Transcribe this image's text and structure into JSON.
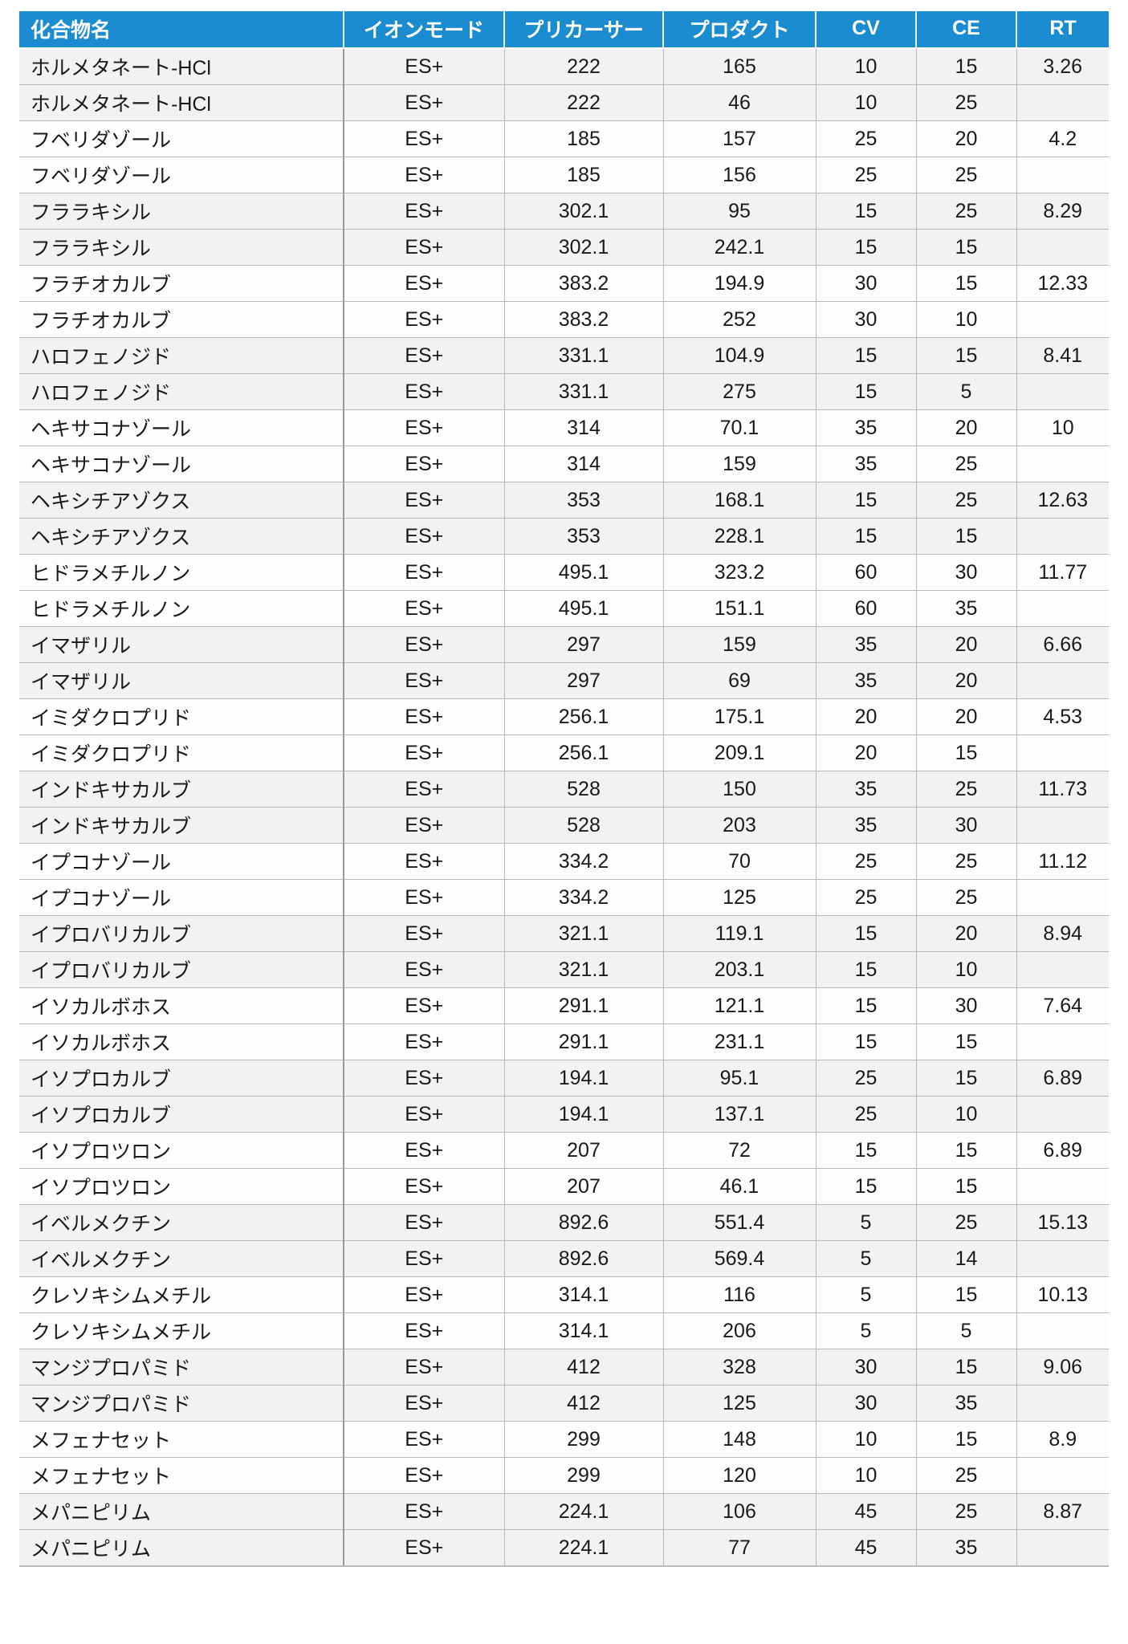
{
  "table": {
    "columns": [
      {
        "key": "name",
        "label": "化合物名"
      },
      {
        "key": "mode",
        "label": "イオンモード"
      },
      {
        "key": "precursor",
        "label": "プリカーサー"
      },
      {
        "key": "product",
        "label": "プロダクト"
      },
      {
        "key": "cv",
        "label": "CV"
      },
      {
        "key": "ce",
        "label": "CE"
      },
      {
        "key": "rt",
        "label": "RT"
      }
    ],
    "header_background": "#1b8cd0",
    "header_text_color": "#ffffff",
    "rows": [
      {
        "name": "ホルメタネート-HCl",
        "mode": "ES+",
        "precursor": "222",
        "product": "165",
        "cv": "10",
        "ce": "15",
        "rt": "3.26"
      },
      {
        "name": "ホルメタネート-HCl",
        "mode": "ES+",
        "precursor": "222",
        "product": "46",
        "cv": "10",
        "ce": "25",
        "rt": ""
      },
      {
        "name": "フベリダゾール",
        "mode": "ES+",
        "precursor": "185",
        "product": "157",
        "cv": "25",
        "ce": "20",
        "rt": "4.2"
      },
      {
        "name": "フベリダゾール",
        "mode": "ES+",
        "precursor": "185",
        "product": "156",
        "cv": "25",
        "ce": "25",
        "rt": ""
      },
      {
        "name": "フララキシル",
        "mode": "ES+",
        "precursor": "302.1",
        "product": "95",
        "cv": "15",
        "ce": "25",
        "rt": "8.29"
      },
      {
        "name": "フララキシル",
        "mode": "ES+",
        "precursor": "302.1",
        "product": "242.1",
        "cv": "15",
        "ce": "15",
        "rt": ""
      },
      {
        "name": "フラチオカルブ",
        "mode": "ES+",
        "precursor": "383.2",
        "product": "194.9",
        "cv": "30",
        "ce": "15",
        "rt": "12.33"
      },
      {
        "name": "フラチオカルブ",
        "mode": "ES+",
        "precursor": "383.2",
        "product": "252",
        "cv": "30",
        "ce": "10",
        "rt": ""
      },
      {
        "name": "ハロフェノジド",
        "mode": "ES+",
        "precursor": "331.1",
        "product": "104.9",
        "cv": "15",
        "ce": "15",
        "rt": "8.41"
      },
      {
        "name": "ハロフェノジド",
        "mode": "ES+",
        "precursor": "331.1",
        "product": "275",
        "cv": "15",
        "ce": "5",
        "rt": ""
      },
      {
        "name": "ヘキサコナゾール",
        "mode": "ES+",
        "precursor": "314",
        "product": "70.1",
        "cv": "35",
        "ce": "20",
        "rt": "10"
      },
      {
        "name": "ヘキサコナゾール",
        "mode": "ES+",
        "precursor": "314",
        "product": "159",
        "cv": "35",
        "ce": "25",
        "rt": ""
      },
      {
        "name": "ヘキシチアゾクス",
        "mode": "ES+",
        "precursor": "353",
        "product": "168.1",
        "cv": "15",
        "ce": "25",
        "rt": "12.63"
      },
      {
        "name": "ヘキシチアゾクス",
        "mode": "ES+",
        "precursor": "353",
        "product": "228.1",
        "cv": "15",
        "ce": "15",
        "rt": ""
      },
      {
        "name": "ヒドラメチルノン",
        "mode": "ES+",
        "precursor": "495.1",
        "product": "323.2",
        "cv": "60",
        "ce": "30",
        "rt": "11.77"
      },
      {
        "name": "ヒドラメチルノン",
        "mode": "ES+",
        "precursor": "495.1",
        "product": "151.1",
        "cv": "60",
        "ce": "35",
        "rt": ""
      },
      {
        "name": "イマザリル",
        "mode": "ES+",
        "precursor": "297",
        "product": "159",
        "cv": "35",
        "ce": "20",
        "rt": "6.66"
      },
      {
        "name": "イマザリル",
        "mode": "ES+",
        "precursor": "297",
        "product": "69",
        "cv": "35",
        "ce": "20",
        "rt": ""
      },
      {
        "name": "イミダクロプリド",
        "mode": "ES+",
        "precursor": "256.1",
        "product": "175.1",
        "cv": "20",
        "ce": "20",
        "rt": "4.53"
      },
      {
        "name": "イミダクロプリド",
        "mode": "ES+",
        "precursor": "256.1",
        "product": "209.1",
        "cv": "20",
        "ce": "15",
        "rt": ""
      },
      {
        "name": "インドキサカルブ",
        "mode": "ES+",
        "precursor": "528",
        "product": "150",
        "cv": "35",
        "ce": "25",
        "rt": "11.73"
      },
      {
        "name": "インドキサカルブ",
        "mode": "ES+",
        "precursor": "528",
        "product": "203",
        "cv": "35",
        "ce": "30",
        "rt": ""
      },
      {
        "name": "イプコナゾール",
        "mode": "ES+",
        "precursor": "334.2",
        "product": "70",
        "cv": "25",
        "ce": "25",
        "rt": "11.12"
      },
      {
        "name": "イプコナゾール",
        "mode": "ES+",
        "precursor": "334.2",
        "product": "125",
        "cv": "25",
        "ce": "25",
        "rt": ""
      },
      {
        "name": "イプロバリカルブ",
        "mode": "ES+",
        "precursor": "321.1",
        "product": "119.1",
        "cv": "15",
        "ce": "20",
        "rt": "8.94"
      },
      {
        "name": "イプロバリカルブ",
        "mode": "ES+",
        "precursor": "321.1",
        "product": "203.1",
        "cv": "15",
        "ce": "10",
        "rt": ""
      },
      {
        "name": "イソカルボホス",
        "mode": "ES+",
        "precursor": "291.1",
        "product": "121.1",
        "cv": "15",
        "ce": "30",
        "rt": "7.64"
      },
      {
        "name": "イソカルボホス",
        "mode": "ES+",
        "precursor": "291.1",
        "product": "231.1",
        "cv": "15",
        "ce": "15",
        "rt": ""
      },
      {
        "name": "イソプロカルブ",
        "mode": "ES+",
        "precursor": "194.1",
        "product": "95.1",
        "cv": "25",
        "ce": "15",
        "rt": "6.89"
      },
      {
        "name": "イソプロカルブ",
        "mode": "ES+",
        "precursor": "194.1",
        "product": "137.1",
        "cv": "25",
        "ce": "10",
        "rt": ""
      },
      {
        "name": "イソプロツロン",
        "mode": "ES+",
        "precursor": "207",
        "product": "72",
        "cv": "15",
        "ce": "15",
        "rt": "6.89"
      },
      {
        "name": "イソプロツロン",
        "mode": "ES+",
        "precursor": "207",
        "product": "46.1",
        "cv": "15",
        "ce": "15",
        "rt": ""
      },
      {
        "name": "イベルメクチン",
        "mode": "ES+",
        "precursor": "892.6",
        "product": "551.4",
        "cv": "5",
        "ce": "25",
        "rt": "15.13"
      },
      {
        "name": "イベルメクチン",
        "mode": "ES+",
        "precursor": "892.6",
        "product": "569.4",
        "cv": "5",
        "ce": "14",
        "rt": ""
      },
      {
        "name": "クレソキシムメチル",
        "mode": "ES+",
        "precursor": "314.1",
        "product": "116",
        "cv": "5",
        "ce": "15",
        "rt": "10.13"
      },
      {
        "name": "クレソキシムメチル",
        "mode": "ES+",
        "precursor": "314.1",
        "product": "206",
        "cv": "5",
        "ce": "5",
        "rt": ""
      },
      {
        "name": "マンジプロパミド",
        "mode": "ES+",
        "precursor": "412",
        "product": "328",
        "cv": "30",
        "ce": "15",
        "rt": "9.06"
      },
      {
        "name": "マンジプロパミド",
        "mode": "ES+",
        "precursor": "412",
        "product": "125",
        "cv": "30",
        "ce": "35",
        "rt": ""
      },
      {
        "name": "メフェナセット",
        "mode": "ES+",
        "precursor": "299",
        "product": "148",
        "cv": "10",
        "ce": "15",
        "rt": "8.9"
      },
      {
        "name": "メフェナセット",
        "mode": "ES+",
        "precursor": "299",
        "product": "120",
        "cv": "10",
        "ce": "25",
        "rt": ""
      },
      {
        "name": "メパニピリム",
        "mode": "ES+",
        "precursor": "224.1",
        "product": "106",
        "cv": "45",
        "ce": "25",
        "rt": "8.87"
      },
      {
        "name": "メパニピリム",
        "mode": "ES+",
        "precursor": "224.1",
        "product": "77",
        "cv": "45",
        "ce": "35",
        "rt": ""
      }
    ]
  }
}
